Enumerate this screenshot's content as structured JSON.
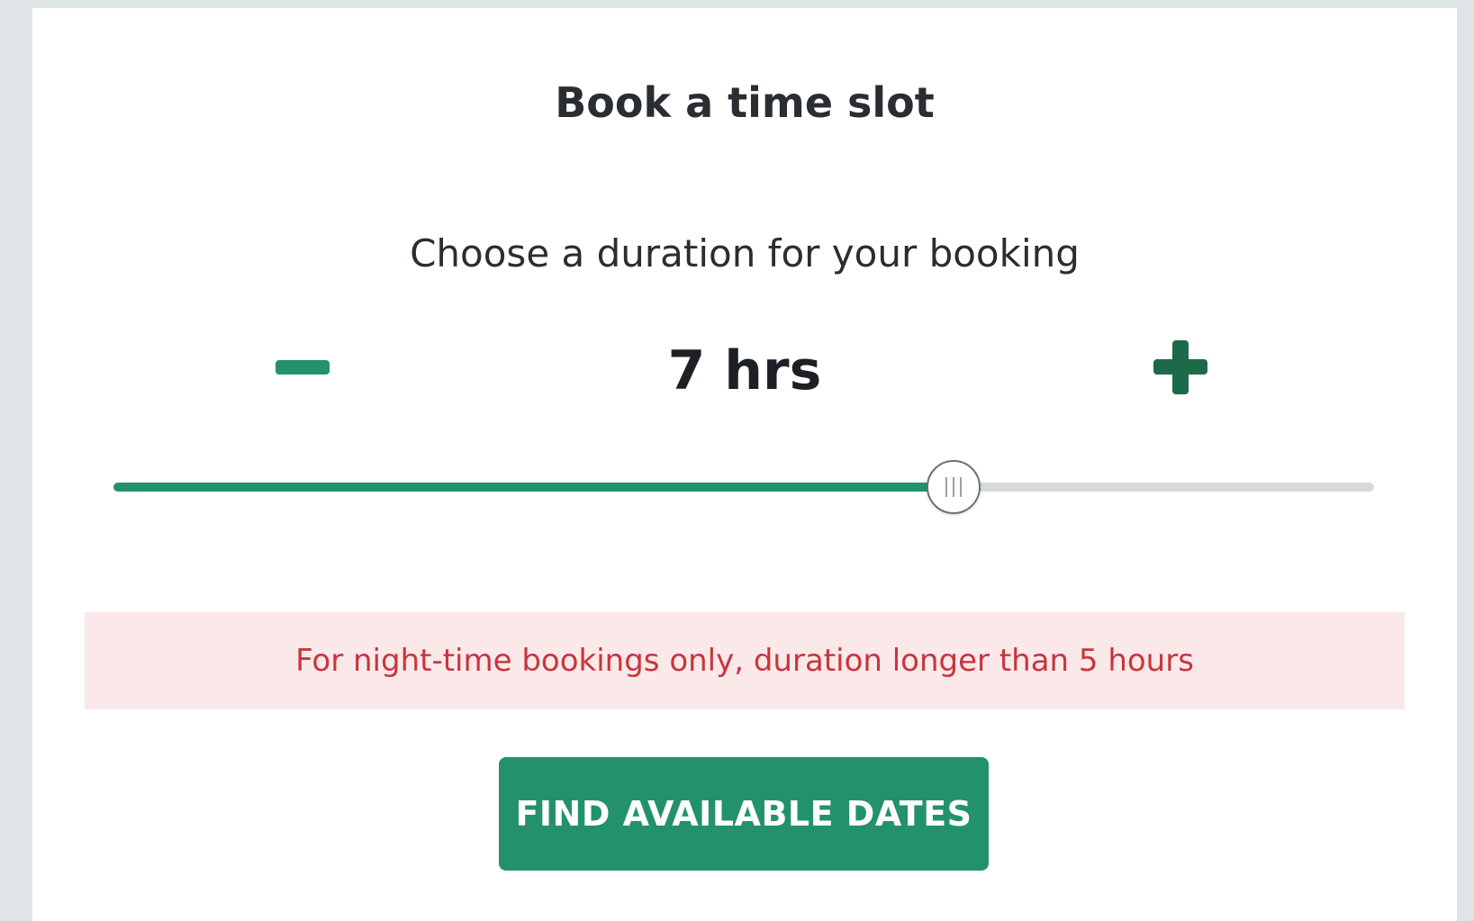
{
  "booking": {
    "title": "Book a time slot",
    "subtitle": "Choose a duration for your booking",
    "duration_label": "7 hrs",
    "slider": {
      "min": 1,
      "max": 10,
      "value": 7
    },
    "alert_text": "For night-time bookings only, duration longer than 5 hours",
    "find_button_label": "FIND AVAILABLE DATES"
  },
  "icons": {
    "decrease": "minus-icon",
    "increase": "plus-icon",
    "slider_thumb": "grip-icon"
  },
  "colors": {
    "accent": "#23926a",
    "accent_dark": "#1d6a49",
    "track": "#d7dadd",
    "alert_bg": "#fbe8e9",
    "alert_text": "#c8353d",
    "page_bg": "#dfe4e6"
  }
}
